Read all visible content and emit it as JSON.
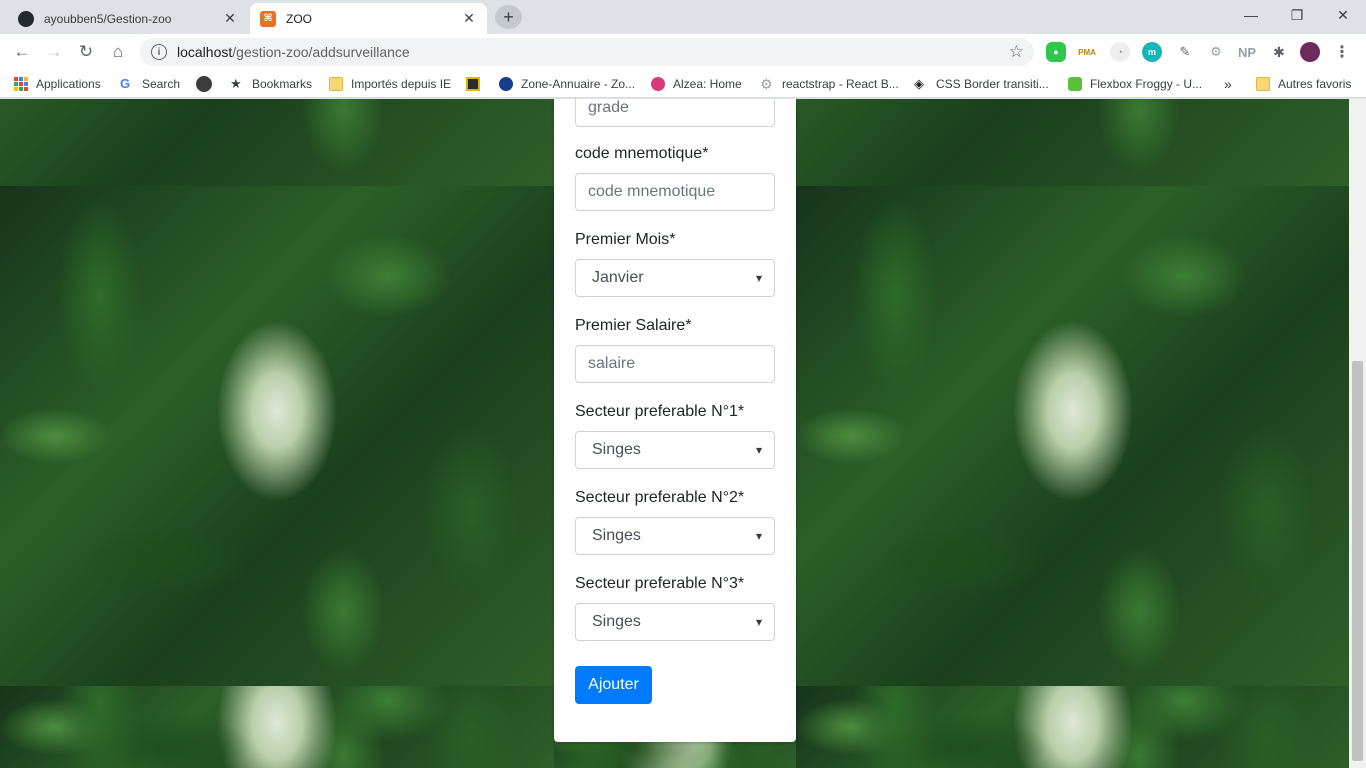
{
  "browser": {
    "tabs": [
      {
        "title": "ayoubben5/Gestion-zoo",
        "icon": "github-icon"
      },
      {
        "title": "ZOO",
        "icon": "zoo-icon",
        "active": true
      }
    ],
    "url_host": "localhost",
    "url_path": "/gestion-zoo/addsurveillance",
    "bookmarks": [
      {
        "label": "Applications"
      },
      {
        "label": "Search"
      },
      {
        "label": ""
      },
      {
        "label": "Bookmarks"
      },
      {
        "label": "Importés depuis IE"
      },
      {
        "label": ""
      },
      {
        "label": "Zone-Annuaire - Zo..."
      },
      {
        "label": "Alzea: Home"
      },
      {
        "label": "reactstrap - React B..."
      },
      {
        "label": "CSS Border transiti..."
      },
      {
        "label": "Flexbox Froggy - U..."
      },
      {
        "label": "Autres favoris"
      }
    ],
    "overflow_label": "»",
    "extensions": {
      "np_label": "NP",
      "pma_label": "PMA",
      "m_label": "m"
    }
  },
  "form": {
    "grade_placeholder": "grade",
    "code_label": "code mnemotique*",
    "code_placeholder": "code mnemotique",
    "mois_label": "Premier Mois*",
    "mois_value": "Janvier",
    "salaire_label": "Premier Salaire*",
    "salaire_placeholder": "salaire",
    "secteur1_label": "Secteur preferable N°1*",
    "secteur1_value": "Singes",
    "secteur2_label": "Secteur preferable N°2*",
    "secteur2_value": "Singes",
    "secteur3_label": "Secteur preferable N°3*",
    "secteur3_value": "Singes",
    "submit_label": "Ajouter"
  },
  "colors": {
    "primary": "#007bff",
    "tabstrip": "#dee1e6"
  }
}
